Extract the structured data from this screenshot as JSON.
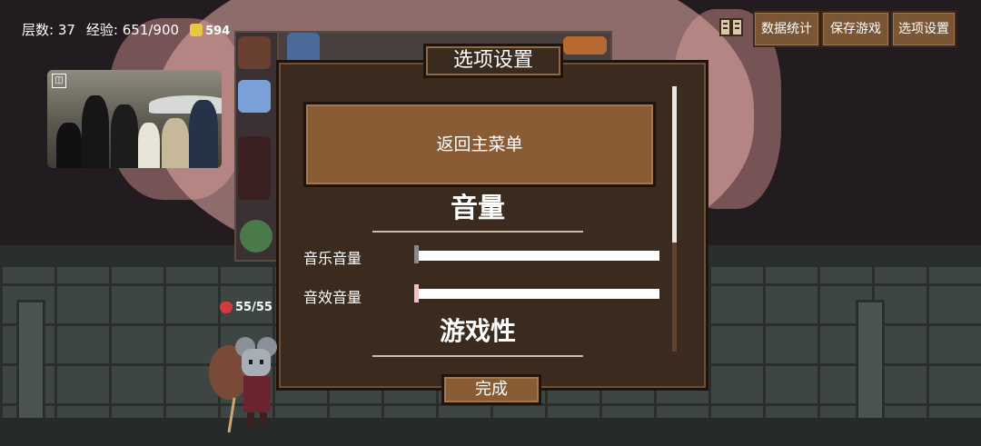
{
  "hud": {
    "floor_label": "层数: 37",
    "exp_label": "经验: 651/900",
    "gold": "594"
  },
  "top_buttons": {
    "stats": "数据统计",
    "save": "保存游戏",
    "options": "选项设置"
  },
  "dialog": {
    "title": "选项设置",
    "main_menu_button": "返回主菜单",
    "section_volume": "音量",
    "music_volume_label": "音乐音量",
    "sfx_volume_label": "音效音量",
    "section_gameplay": "游戏性",
    "done_button": "完成",
    "music_volume": 0,
    "sfx_volume": 0
  },
  "player": {
    "hp": "55/55"
  },
  "colors": {
    "button_brown": "#7a5635",
    "dialog_bg": "#3a2b1e",
    "heart_red": "#d43a3a",
    "coin_gold": "#e8c840"
  },
  "icons": [
    "book-icon",
    "coin-icon",
    "heart-icon"
  ]
}
